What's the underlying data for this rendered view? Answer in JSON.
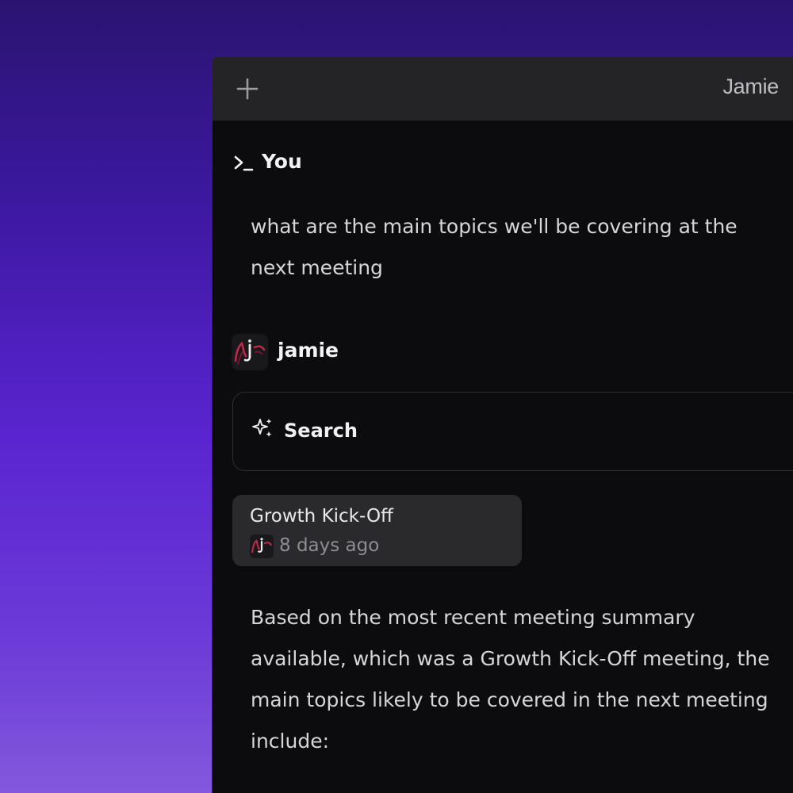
{
  "window": {
    "title": "Jamie",
    "new_chat_icon": "plus-icon"
  },
  "conversation": {
    "user": {
      "icon": "terminal-icon",
      "name": "You",
      "message_lines": [
        "what are the main topics we'll be covering at the",
        "next meeting"
      ]
    },
    "assistant": {
      "avatar_icon": "jamie-logo-icon",
      "name": "jamie",
      "tool": {
        "icon": "sparkle-icon",
        "label": "Search"
      },
      "source": {
        "title": "Growth Kick-Off",
        "avatar_icon": "jamie-logo-icon",
        "time": "8 days ago"
      },
      "message_lines": [
        "Based on the most recent meeting summary",
        "available, which was a Growth Kick-Off meeting, the",
        "main topics likely to be covered in the next meeting",
        "include:"
      ]
    }
  },
  "colors": {
    "window_bg": "#0c0c0e",
    "titlebar_bg": "#242426",
    "source_card_bg": "#2a2a2d",
    "accent_logo": "#c0284a"
  }
}
